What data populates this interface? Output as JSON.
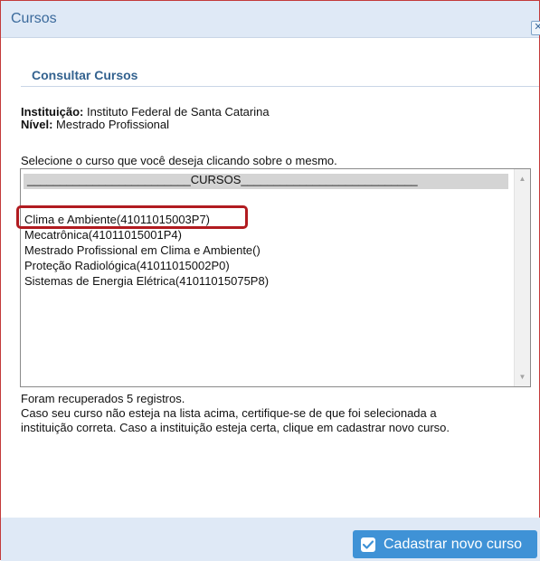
{
  "dialog": {
    "title": "Cursos",
    "close_icon": "close-icon"
  },
  "section": {
    "title": "Consultar Cursos"
  },
  "info": {
    "instituicao_label": "Instituição:",
    "instituicao_value": "Instituto Federal de Santa Catarina",
    "nivel_label": "Nível:",
    "nivel_value": "Mestrado Profissional"
  },
  "instruction": "Selecione o curso que você deseja clicando sobre o mesmo.",
  "list": {
    "header": "_________________________CURSOS___________________________",
    "items": [
      {
        "label": "Clima e Ambiente(41011015003P7)"
      },
      {
        "label": "Mecatrônica(41011015001P4)"
      },
      {
        "label": "Mestrado Profissional em Clima e Ambiente()"
      },
      {
        "label": "Proteção Radiológica(41011015002P0)"
      },
      {
        "label": "Sistemas de Energia Elétrica(41011015075P8)"
      }
    ]
  },
  "footer": {
    "line1": "Foram recuperados 5 registros.",
    "line2": "Caso seu curso não esteja na lista acima, certifique-se de que foi selecionada a",
    "line3": "instituição correta. Caso a instituição esteja certa, clique em cadastrar novo curso."
  },
  "button": {
    "label": "Cadastrar novo curso",
    "icon": "check-icon"
  },
  "colors": {
    "accent": "#3f92d6",
    "titlebar_bg": "#dfe9f6",
    "highlight_border": "#b11b20"
  }
}
